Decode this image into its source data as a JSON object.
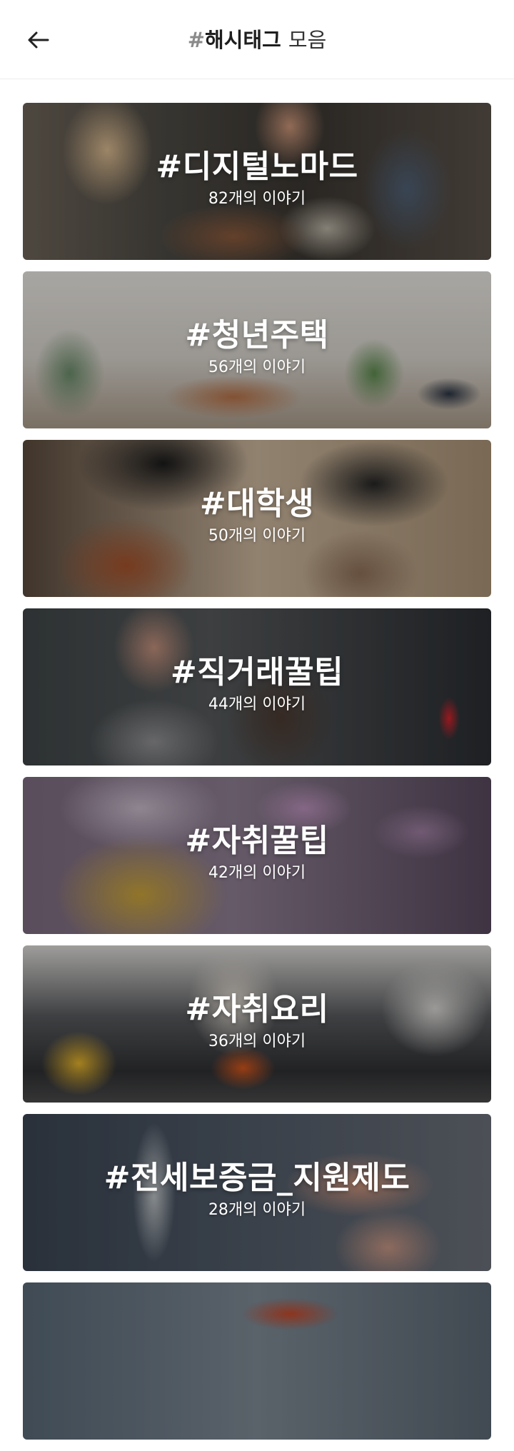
{
  "header": {
    "back_icon": "arrow-left-icon",
    "title_hash": "#",
    "title_main": "해시태그",
    "title_suffix": "모음"
  },
  "cards": [
    {
      "tag": "#디지털노마드",
      "count": "82개의 이야기"
    },
    {
      "tag": "#청년주택",
      "count": "56개의 이야기"
    },
    {
      "tag": "#대학생",
      "count": "50개의 이야기"
    },
    {
      "tag": "#직거래꿀팁",
      "count": "44개의 이야기"
    },
    {
      "tag": "#자취꿀팁",
      "count": "42개의 이야기"
    },
    {
      "tag": "#자취요리",
      "count": "36개의 이야기"
    },
    {
      "tag": "#전세보증금_지원제도",
      "count": "28개의 이야기"
    },
    {
      "tag": "",
      "count": ""
    }
  ]
}
